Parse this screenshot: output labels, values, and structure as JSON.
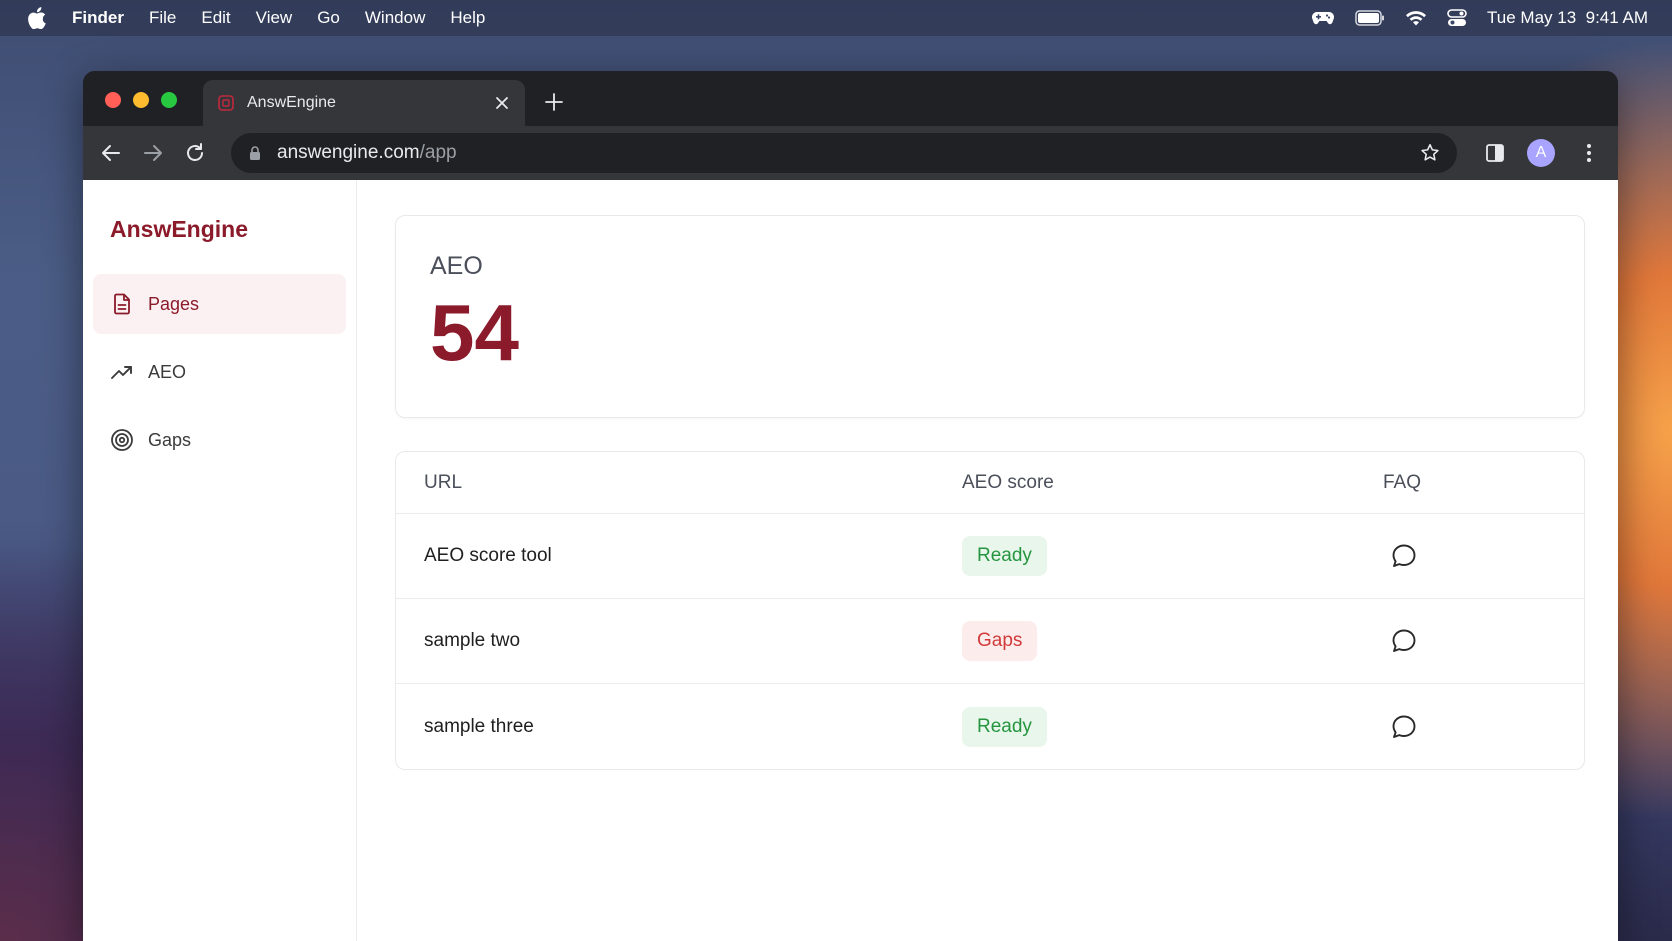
{
  "menubar": {
    "app": "Finder",
    "items": [
      "File",
      "Edit",
      "View",
      "Go",
      "Window",
      "Help"
    ],
    "clock": "Tue May 13  9:41 AM"
  },
  "browser": {
    "tab_title": "AnswEngine",
    "url_host": "answengine.com",
    "url_path": "/app",
    "profile_initial": "A"
  },
  "sidebar": {
    "brand": "AnswEngine",
    "items": [
      {
        "label": "Pages",
        "icon": "document-icon",
        "active": true
      },
      {
        "label": "AEO",
        "icon": "trending-up-icon",
        "active": false
      },
      {
        "label": "Gaps",
        "icon": "target-icon",
        "active": false
      }
    ]
  },
  "score": {
    "label": "AEO",
    "value": "54"
  },
  "table": {
    "headers": [
      "URL",
      "AEO score",
      "FAQ"
    ],
    "rows": [
      {
        "url": "AEO score tool",
        "status": "Ready",
        "faq_icon": "chat-bubble-icon"
      },
      {
        "url": "sample two",
        "status": "Gaps",
        "faq_icon": "chat-bubble-icon"
      },
      {
        "url": "sample three",
        "status": "Ready",
        "faq_icon": "chat-bubble-icon"
      }
    ]
  },
  "colors": {
    "brand": "#8b1a2b",
    "ready": "#26953f",
    "gaps": "#d23a3a"
  }
}
